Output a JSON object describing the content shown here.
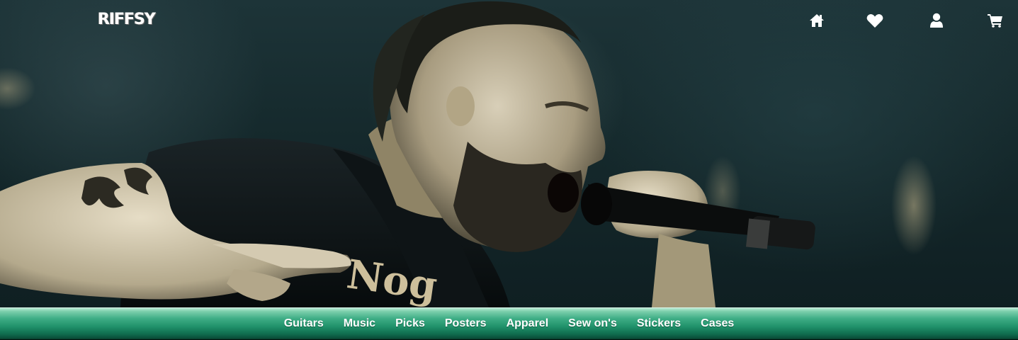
{
  "brand": {
    "logo_text": "RIFFSY"
  },
  "hero": {
    "image_description_name": "singer-photo"
  },
  "header_icons": [
    {
      "name": "home-icon"
    },
    {
      "name": "heart-icon"
    },
    {
      "name": "user-icon"
    },
    {
      "name": "cart-icon"
    }
  ],
  "nav": {
    "items": [
      {
        "label": "Guitars"
      },
      {
        "label": "Music"
      },
      {
        "label": "Picks"
      },
      {
        "label": "Posters"
      },
      {
        "label": "Apparel"
      },
      {
        "label": "Sew on's"
      },
      {
        "label": "Stickers"
      },
      {
        "label": "Cases"
      }
    ]
  },
  "colors": {
    "nav_green": "#20916a",
    "hero_tint": "#1d3438",
    "icon_white": "#ffffff"
  }
}
